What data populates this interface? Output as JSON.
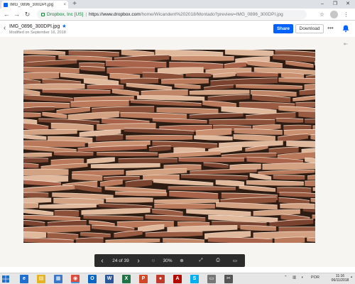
{
  "browser": {
    "tab_title": "IMG_0896_300DPI.jpg",
    "tab_close": "×",
    "new_tab": "+",
    "window_controls": {
      "minimize": "–",
      "restore": "❐",
      "close": "✕"
    },
    "back": "←",
    "forward": "→",
    "reload": "↻",
    "site_identity": "Dropbox, Inc [US]",
    "url_host": "https://www.dropbox.com",
    "url_path": "/home/Wicandent%202018/Montado?preview=IMG_0896_300DPI.jpg",
    "star": "☆",
    "menu": "⋮"
  },
  "header": {
    "back": "‹",
    "filename": "IMG_0896_300DPI.jpg",
    "star": "★",
    "modified": "Modified on September 16, 2018",
    "share_label": "Share",
    "download_label": "Download",
    "more_label": "•••",
    "side_toggle": "⇤"
  },
  "controls": {
    "prev": "‹",
    "page": "24 of 39",
    "next": "›",
    "zoom_out": "⊖",
    "zoom": "30%",
    "zoom_in": "⊕",
    "fullscreen": "⤢",
    "print": "⎙",
    "comment": "▭"
  },
  "taskbar": {
    "apps": [
      {
        "name": "ie",
        "label": "e",
        "color": "#1e6fcf"
      },
      {
        "name": "explorer",
        "label": "▤",
        "color": "#e6b422"
      },
      {
        "name": "store",
        "label": "▦",
        "color": "#3a78c7"
      },
      {
        "name": "chrome",
        "label": "◉",
        "color": "#d94b3a"
      },
      {
        "name": "outlook",
        "label": "O",
        "color": "#0a66c2"
      },
      {
        "name": "word",
        "label": "W",
        "color": "#2b579a"
      },
      {
        "name": "excel",
        "label": "X",
        "color": "#217346"
      },
      {
        "name": "powerpoint",
        "label": "P",
        "color": "#d24726"
      },
      {
        "name": "app-red",
        "label": "●",
        "color": "#c0392b"
      },
      {
        "name": "acrobat",
        "label": "A",
        "color": "#b30b00"
      },
      {
        "name": "skype",
        "label": "S",
        "color": "#00aff0"
      },
      {
        "name": "app-gray",
        "label": "▭",
        "color": "#777777"
      },
      {
        "name": "snip",
        "label": "✂",
        "color": "#555555"
      }
    ],
    "lang": "POR",
    "time": "11:16",
    "date": "06/11/2018"
  }
}
